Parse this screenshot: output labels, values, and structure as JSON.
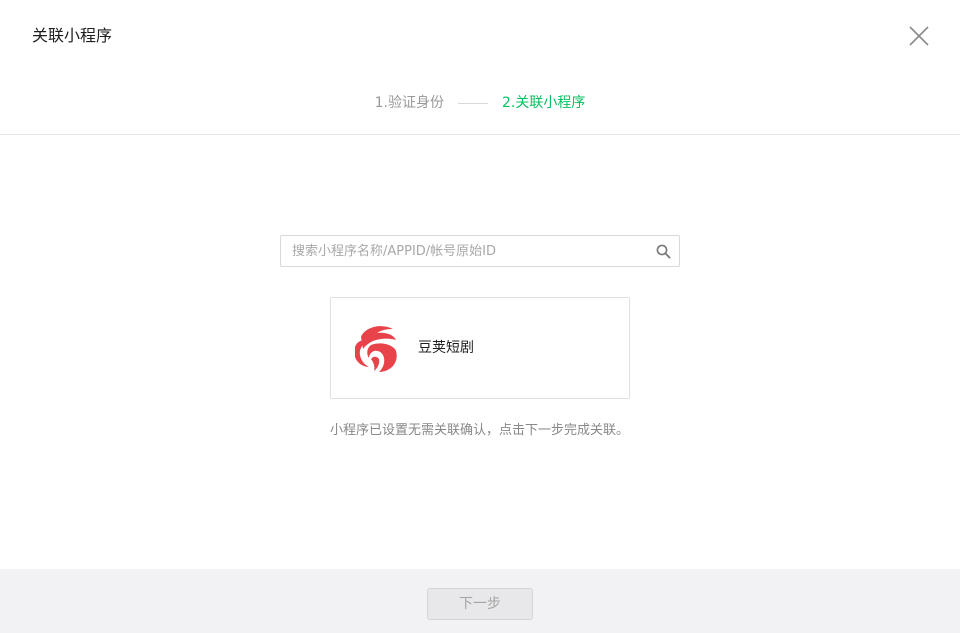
{
  "dialog": {
    "title": "关联小程序",
    "close_icon": "close-icon"
  },
  "steps": [
    {
      "label": "1.验证身份",
      "active": false
    },
    {
      "label": "2.关联小程序",
      "active": true
    }
  ],
  "search": {
    "placeholder": "搜索小程序名称/APPID/帐号原始ID",
    "value": "",
    "icon": "search-icon"
  },
  "result": {
    "name": "豆荚短剧",
    "logo_icon": "miniapp-logo-icon"
  },
  "hint": "小程序已设置无需关联确认，点击下一步完成关联。",
  "footer": {
    "next_label": "下一步"
  },
  "colors": {
    "accent": "#07c160",
    "logo_red": "#e8434b",
    "muted_text": "#999999"
  }
}
